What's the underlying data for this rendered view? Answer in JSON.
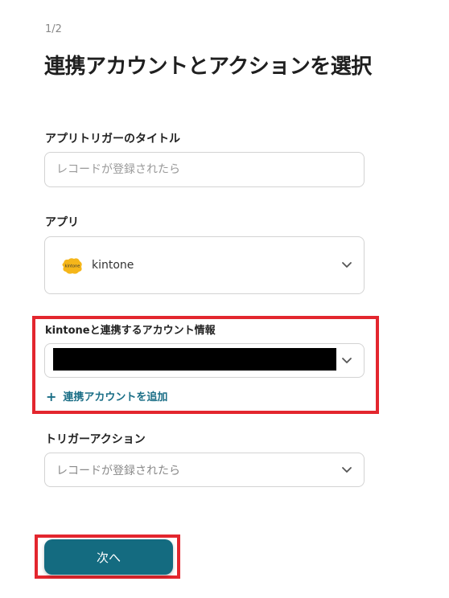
{
  "header": {
    "step": "1/2",
    "title": "連携アカウントとアクションを選択"
  },
  "form": {
    "trigger_title": {
      "label": "アプリトリガーのタイトル",
      "placeholder": "レコードが登録されたら"
    },
    "app": {
      "label": "アプリ",
      "selected": "kintone",
      "logo_text": "kintone",
      "logo_color": "#f5b61a",
      "icon": "chevron-down-icon"
    },
    "account": {
      "label": "kintoneと連携するアカウント情報",
      "add_link": "連携アカウントを追加",
      "add_icon": "plus-icon"
    },
    "trigger_action": {
      "label": "トリガーアクション",
      "selected": "レコードが登録されたら"
    },
    "next_button": "次へ"
  },
  "colors": {
    "accent": "#146b80",
    "highlight": "#e3262e",
    "link": "#1a6e86"
  }
}
